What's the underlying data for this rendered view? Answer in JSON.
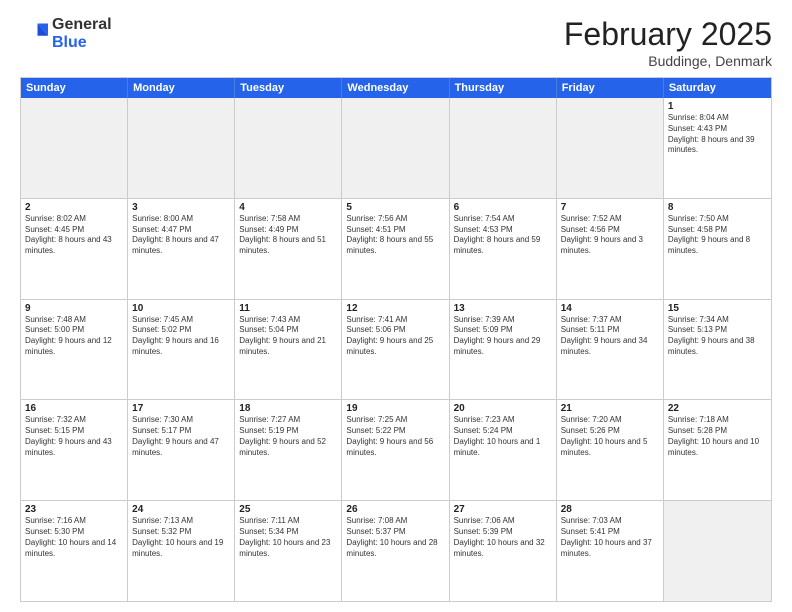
{
  "header": {
    "logo_general": "General",
    "logo_blue": "Blue",
    "title": "February 2025",
    "location": "Buddinge, Denmark"
  },
  "days_of_week": [
    "Sunday",
    "Monday",
    "Tuesday",
    "Wednesday",
    "Thursday",
    "Friday",
    "Saturday"
  ],
  "rows": [
    [
      {
        "day": "",
        "text": "",
        "shaded": true
      },
      {
        "day": "",
        "text": "",
        "shaded": true
      },
      {
        "day": "",
        "text": "",
        "shaded": true
      },
      {
        "day": "",
        "text": "",
        "shaded": true
      },
      {
        "day": "",
        "text": "",
        "shaded": true
      },
      {
        "day": "",
        "text": "",
        "shaded": true
      },
      {
        "day": "1",
        "text": "Sunrise: 8:04 AM\nSunset: 4:43 PM\nDaylight: 8 hours and 39 minutes."
      }
    ],
    [
      {
        "day": "2",
        "text": "Sunrise: 8:02 AM\nSunset: 4:45 PM\nDaylight: 8 hours and 43 minutes."
      },
      {
        "day": "3",
        "text": "Sunrise: 8:00 AM\nSunset: 4:47 PM\nDaylight: 8 hours and 47 minutes."
      },
      {
        "day": "4",
        "text": "Sunrise: 7:58 AM\nSunset: 4:49 PM\nDaylight: 8 hours and 51 minutes."
      },
      {
        "day": "5",
        "text": "Sunrise: 7:56 AM\nSunset: 4:51 PM\nDaylight: 8 hours and 55 minutes."
      },
      {
        "day": "6",
        "text": "Sunrise: 7:54 AM\nSunset: 4:53 PM\nDaylight: 8 hours and 59 minutes."
      },
      {
        "day": "7",
        "text": "Sunrise: 7:52 AM\nSunset: 4:56 PM\nDaylight: 9 hours and 3 minutes."
      },
      {
        "day": "8",
        "text": "Sunrise: 7:50 AM\nSunset: 4:58 PM\nDaylight: 9 hours and 8 minutes."
      }
    ],
    [
      {
        "day": "9",
        "text": "Sunrise: 7:48 AM\nSunset: 5:00 PM\nDaylight: 9 hours and 12 minutes."
      },
      {
        "day": "10",
        "text": "Sunrise: 7:45 AM\nSunset: 5:02 PM\nDaylight: 9 hours and 16 minutes."
      },
      {
        "day": "11",
        "text": "Sunrise: 7:43 AM\nSunset: 5:04 PM\nDaylight: 9 hours and 21 minutes."
      },
      {
        "day": "12",
        "text": "Sunrise: 7:41 AM\nSunset: 5:06 PM\nDaylight: 9 hours and 25 minutes."
      },
      {
        "day": "13",
        "text": "Sunrise: 7:39 AM\nSunset: 5:09 PM\nDaylight: 9 hours and 29 minutes."
      },
      {
        "day": "14",
        "text": "Sunrise: 7:37 AM\nSunset: 5:11 PM\nDaylight: 9 hours and 34 minutes."
      },
      {
        "day": "15",
        "text": "Sunrise: 7:34 AM\nSunset: 5:13 PM\nDaylight: 9 hours and 38 minutes."
      }
    ],
    [
      {
        "day": "16",
        "text": "Sunrise: 7:32 AM\nSunset: 5:15 PM\nDaylight: 9 hours and 43 minutes."
      },
      {
        "day": "17",
        "text": "Sunrise: 7:30 AM\nSunset: 5:17 PM\nDaylight: 9 hours and 47 minutes."
      },
      {
        "day": "18",
        "text": "Sunrise: 7:27 AM\nSunset: 5:19 PM\nDaylight: 9 hours and 52 minutes."
      },
      {
        "day": "19",
        "text": "Sunrise: 7:25 AM\nSunset: 5:22 PM\nDaylight: 9 hours and 56 minutes."
      },
      {
        "day": "20",
        "text": "Sunrise: 7:23 AM\nSunset: 5:24 PM\nDaylight: 10 hours and 1 minute."
      },
      {
        "day": "21",
        "text": "Sunrise: 7:20 AM\nSunset: 5:26 PM\nDaylight: 10 hours and 5 minutes."
      },
      {
        "day": "22",
        "text": "Sunrise: 7:18 AM\nSunset: 5:28 PM\nDaylight: 10 hours and 10 minutes."
      }
    ],
    [
      {
        "day": "23",
        "text": "Sunrise: 7:16 AM\nSunset: 5:30 PM\nDaylight: 10 hours and 14 minutes."
      },
      {
        "day": "24",
        "text": "Sunrise: 7:13 AM\nSunset: 5:32 PM\nDaylight: 10 hours and 19 minutes."
      },
      {
        "day": "25",
        "text": "Sunrise: 7:11 AM\nSunset: 5:34 PM\nDaylight: 10 hours and 23 minutes."
      },
      {
        "day": "26",
        "text": "Sunrise: 7:08 AM\nSunset: 5:37 PM\nDaylight: 10 hours and 28 minutes."
      },
      {
        "day": "27",
        "text": "Sunrise: 7:06 AM\nSunset: 5:39 PM\nDaylight: 10 hours and 32 minutes."
      },
      {
        "day": "28",
        "text": "Sunrise: 7:03 AM\nSunset: 5:41 PM\nDaylight: 10 hours and 37 minutes."
      },
      {
        "day": "",
        "text": "",
        "shaded": true
      }
    ]
  ]
}
